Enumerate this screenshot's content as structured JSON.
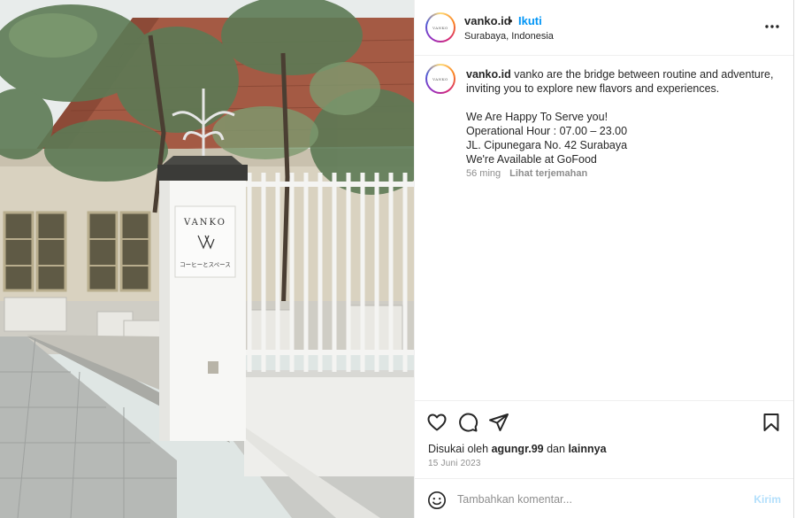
{
  "post": {
    "username": "vanko.id",
    "separator": "•",
    "follow_label": "Ikuti",
    "location": "Surabaya, Indonesia",
    "avatar_text": "VANKO",
    "caption": {
      "username": "vanko.id",
      "text": "vanko are the bridge between routine and adventure, inviting you to explore new flavors and experiences.",
      "lines": [
        "We Are Happy To Serve you!",
        "Operational Hour : 07.00 – 23.00",
        "JL. Cipunegara No. 42 Surabaya",
        "We're Available at GoFood"
      ]
    },
    "time_ago": "56 ming",
    "translate_label": "Lihat terjemahan",
    "likes": {
      "prefix": "Disukai oleh",
      "user": "agungr.99",
      "conjunction": "dan",
      "others": "lainnya"
    },
    "date": "15 Juni 2023"
  },
  "photo": {
    "sign_brand": "VANKO",
    "sign_sub": "コーヒーとスペース"
  },
  "comment": {
    "placeholder": "Tambahkan komentar...",
    "send_label": "Kirim"
  },
  "icons": [
    "more-options-icon",
    "heart-icon",
    "comment-icon",
    "share-icon",
    "bookmark-icon",
    "emoji-icon"
  ],
  "colors": {
    "accent": "#0095f6",
    "send_disabled": "#b2dffc",
    "muted_text": "#8e8e8e"
  }
}
